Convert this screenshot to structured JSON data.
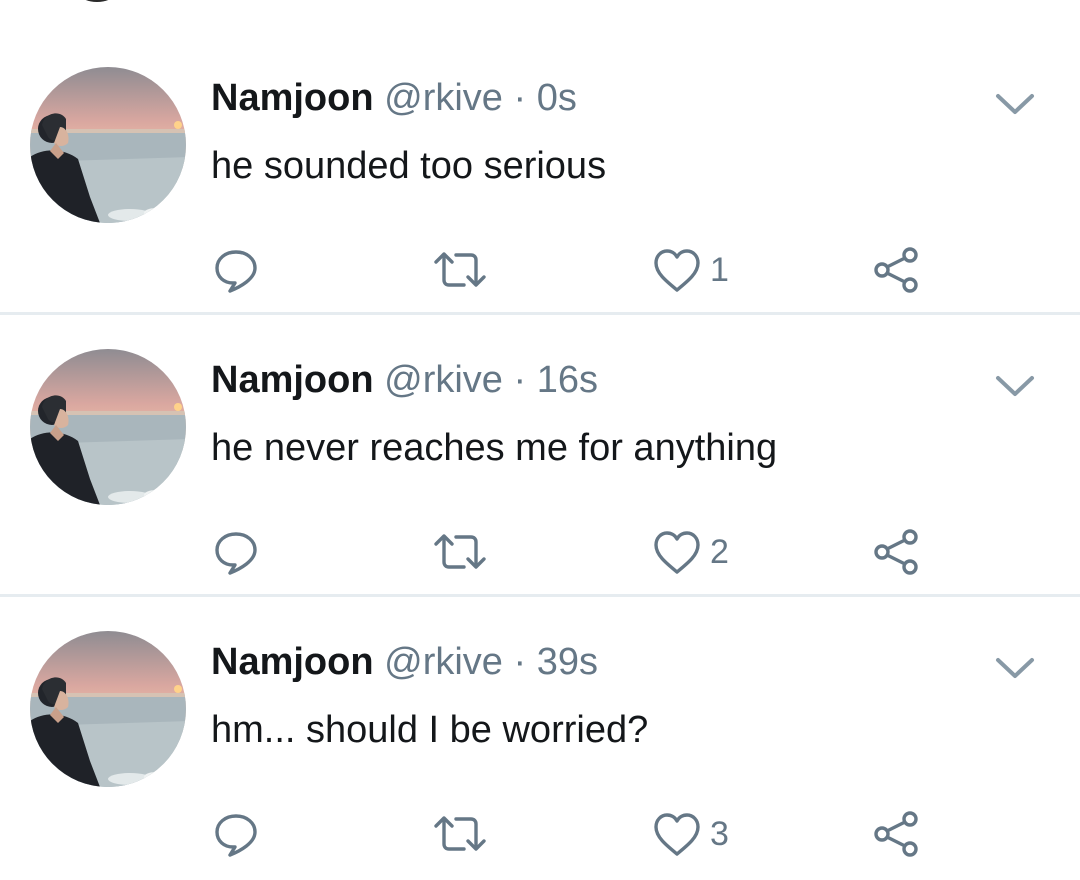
{
  "colors": {
    "text_primary": "#14171a",
    "text_secondary": "#657786",
    "divider": "#e6ecf0"
  },
  "tweets": [
    {
      "name": "Namjoon",
      "handle": "@rkive",
      "separator": "·",
      "time": "0s",
      "text": "he sounded too serious",
      "likes": "1",
      "icons": [
        "reply-icon",
        "retweet-icon",
        "like-icon",
        "share-icon",
        "chevron-down-icon"
      ]
    },
    {
      "name": "Namjoon",
      "handle": "@rkive",
      "separator": "·",
      "time": "16s",
      "text": "he never reaches me for anything",
      "likes": "2",
      "icons": [
        "reply-icon",
        "retweet-icon",
        "like-icon",
        "share-icon",
        "chevron-down-icon"
      ]
    },
    {
      "name": "Namjoon",
      "handle": "@rkive",
      "separator": "·",
      "time": "39s",
      "text": "hm... should I be worried?",
      "likes": "3",
      "icons": [
        "reply-icon",
        "retweet-icon",
        "like-icon",
        "share-icon",
        "chevron-down-icon"
      ]
    }
  ]
}
